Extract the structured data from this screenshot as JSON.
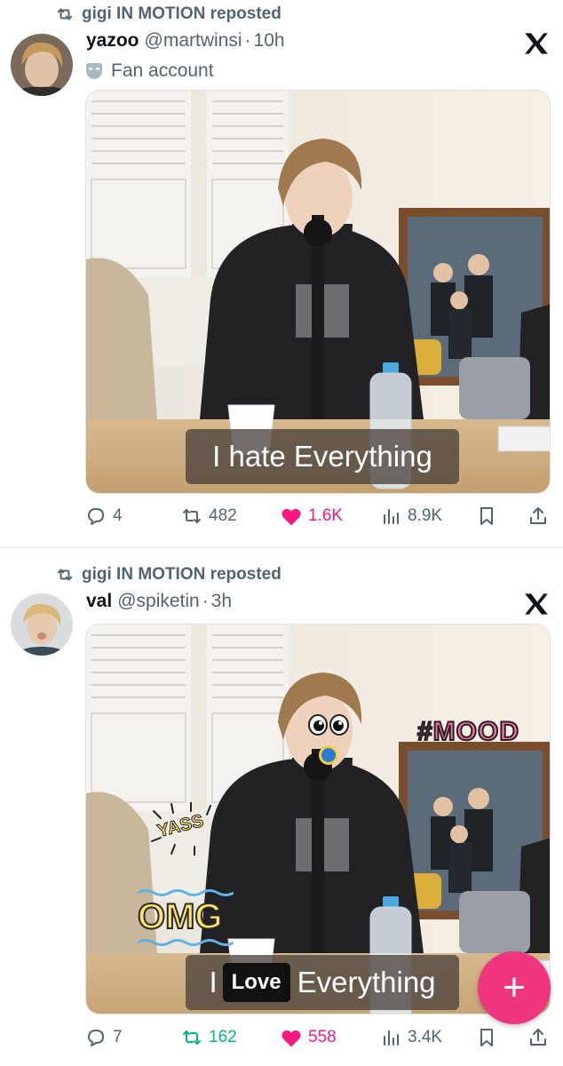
{
  "colors": {
    "like": "#f91880",
    "repost_active": "#00ba7c",
    "muted": "#536471",
    "fab": "#f0357f"
  },
  "tweets": [
    {
      "repost_label": "gigi IN MOTION reposted",
      "name": "yazoo",
      "handle": "@martwinsi",
      "separator": "·",
      "time": "10h",
      "badge": "Fan account",
      "caption": "I hate Everything",
      "replies": "4",
      "reposts": "482",
      "likes": "1.6K",
      "views": "8.9K",
      "liked": true,
      "reposted": false
    },
    {
      "repost_label": "gigi IN MOTION reposted",
      "name": "val",
      "handle": "@spiketin",
      "separator": "·",
      "time": "3h",
      "caption_prefix": "I",
      "caption_chip": "Love",
      "caption_suffix": "Everything",
      "stickers": {
        "mood": "#MOOD",
        "omg": "OMG",
        "yass": "YASS"
      },
      "replies": "7",
      "reposts": "162",
      "likes": "558",
      "views": "3.4K",
      "liked": true,
      "reposted": true
    }
  ],
  "fab": {
    "icon": "plus-icon",
    "label": "+"
  }
}
